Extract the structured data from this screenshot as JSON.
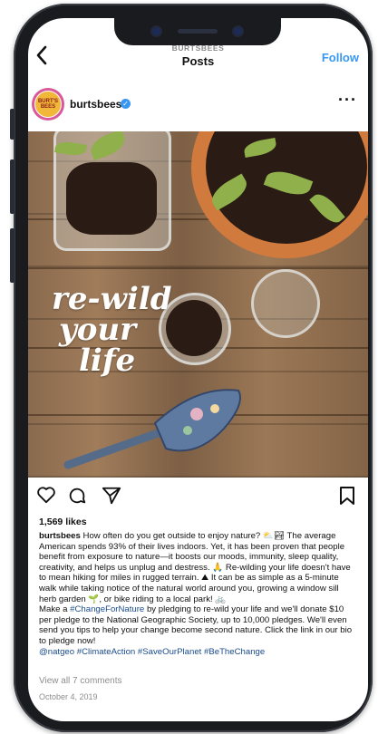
{
  "header": {
    "account": "BURTSBEES",
    "title": "Posts",
    "back_icon": "chevron-left-icon",
    "follow_label": "Follow"
  },
  "post": {
    "username": "burtsbees",
    "avatar_text": "BURT'S BEES",
    "more_icon": "more-horizontal-icon",
    "image_text": [
      "re-wild",
      "your",
      "life"
    ],
    "likes": "1,569 likes",
    "caption": {
      "username": "burtsbees",
      "text_1": "How often do you get outside to enjoy nature? ⛅🏞 The average American spends 93% of their lives indoors. Yet, it has been proven that people benefit from exposure to nature—it boosts our moods, immunity, sleep quality, creativity, and helps us unplug and destress. 🙏 Re-wilding your life doesn't have to mean hiking for miles in rugged terrain. ⛰ It can be as simple as a 5-minute walk while taking notice of the natural world around you, growing a window sill herb garden 🌱, or bike riding to a local park! 🚲",
      "text_2a": "Make a ",
      "hashtag_1": "#ChangeForNature",
      "text_2b": " by pledging to re-wild your life and we'll donate $10 per pledge to the National Geographic Society, up to 10,000 pledges. We'll even send you tips to help your change become second nature. Click the link in our bio to pledge now!",
      "tags_line": "@natgeo #ClimateAction #SaveOurPlanet #BeTheChange"
    },
    "comments_link": "View all 7 comments",
    "date": "October 4, 2019"
  },
  "colors": {
    "accent": "#3897f0",
    "hashtag": "#1a4b8c"
  }
}
